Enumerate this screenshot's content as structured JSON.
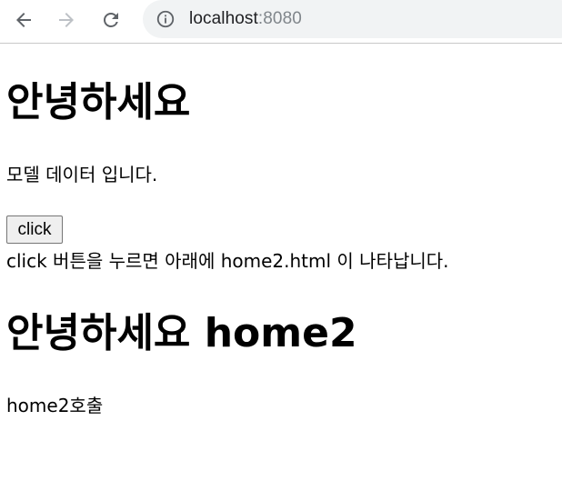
{
  "browser": {
    "url_host": "localhost",
    "url_port": ":8080",
    "icons": {
      "back": "arrow-left-icon",
      "forward": "arrow-right-icon",
      "reload": "reload-icon",
      "site_info": "info-icon"
    },
    "colors": {
      "icon": "#5f6368",
      "icon_disabled": "#bdc1c6",
      "omnibox_bg": "#f1f3f4"
    }
  },
  "page": {
    "heading1": "안녕하세요",
    "model_text": "모델 데이터 입니다.",
    "button_label": "click",
    "description": "click 버튼을 누르면 아래에 home2.html 이 나타납니다.",
    "heading2": "안녕하세요 home2",
    "home2_text": "home2호출"
  }
}
